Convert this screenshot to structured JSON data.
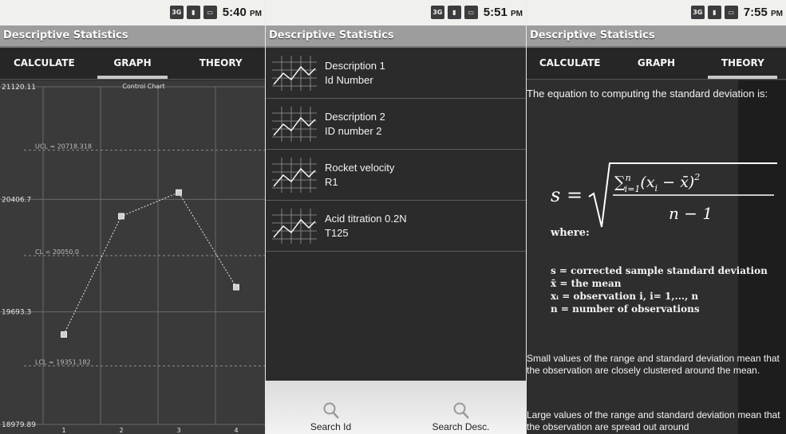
{
  "screens": [
    {
      "time": "5:40",
      "ampm": "PM",
      "title": "Descriptive Statistics",
      "tabs": [
        "CALCULATE",
        "GRAPH",
        "THEORY"
      ],
      "active_tab": 1
    },
    {
      "time": "5:51",
      "ampm": "PM",
      "title": "Descriptive Statistics",
      "items": [
        {
          "line1": "Description 1",
          "line2": "Id Number"
        },
        {
          "line1": "Description 2",
          "line2": "ID number 2"
        },
        {
          "line1": "Rocket velocity",
          "line2": "R1"
        },
        {
          "line1": "Acid titration 0.2N",
          "line2": "T125"
        }
      ],
      "buttons": {
        "search_id": "Search Id",
        "search_desc": "Search Desc."
      }
    },
    {
      "time": "7:55",
      "ampm": "PM",
      "title": "Descriptive Statistics",
      "tabs": [
        "CALCULATE",
        "GRAPH",
        "THEORY"
      ],
      "active_tab": 2,
      "intro": "The equation to computing the standard deviation is:",
      "where": "where:",
      "definitions": [
        "s = corrected sample standard deviation",
        "x̄ = the mean",
        "xᵢ = observation i, i= 1,..., n",
        "n = number of observations"
      ],
      "para_small": "Small values of the range and standard deviation mean that the observation are closely clustered around the mean.",
      "para_large": "Large values of the range and standard deviation mean that the observation are spread out around"
    }
  ],
  "status_icons": [
    "3g-icon",
    "signal-icon",
    "battery-icon"
  ],
  "colors": {
    "status_bar": "#f0f0ec",
    "title_bar": "#9d9d9d",
    "tab_bar": "#262626",
    "chart_bg": "#3a3a3a"
  },
  "chart_data": {
    "type": "line",
    "title": "Control Chart",
    "x": [
      1,
      2,
      3,
      4
    ],
    "values": [
      19550,
      20300,
      20450,
      19850
    ],
    "y_tick_labels": [
      "21120.11",
      "20406.7",
      "19693.3",
      "18979.89"
    ],
    "control_lines": [
      {
        "label": "UCL = 20718.318",
        "value": 20718.318
      },
      {
        "label": "CL = 20050.0",
        "value": 20050.0
      },
      {
        "label": "LCL = 19351.182",
        "value": 19351.182
      }
    ],
    "ylim": [
      18979.89,
      21120.11
    ],
    "grid": true
  }
}
